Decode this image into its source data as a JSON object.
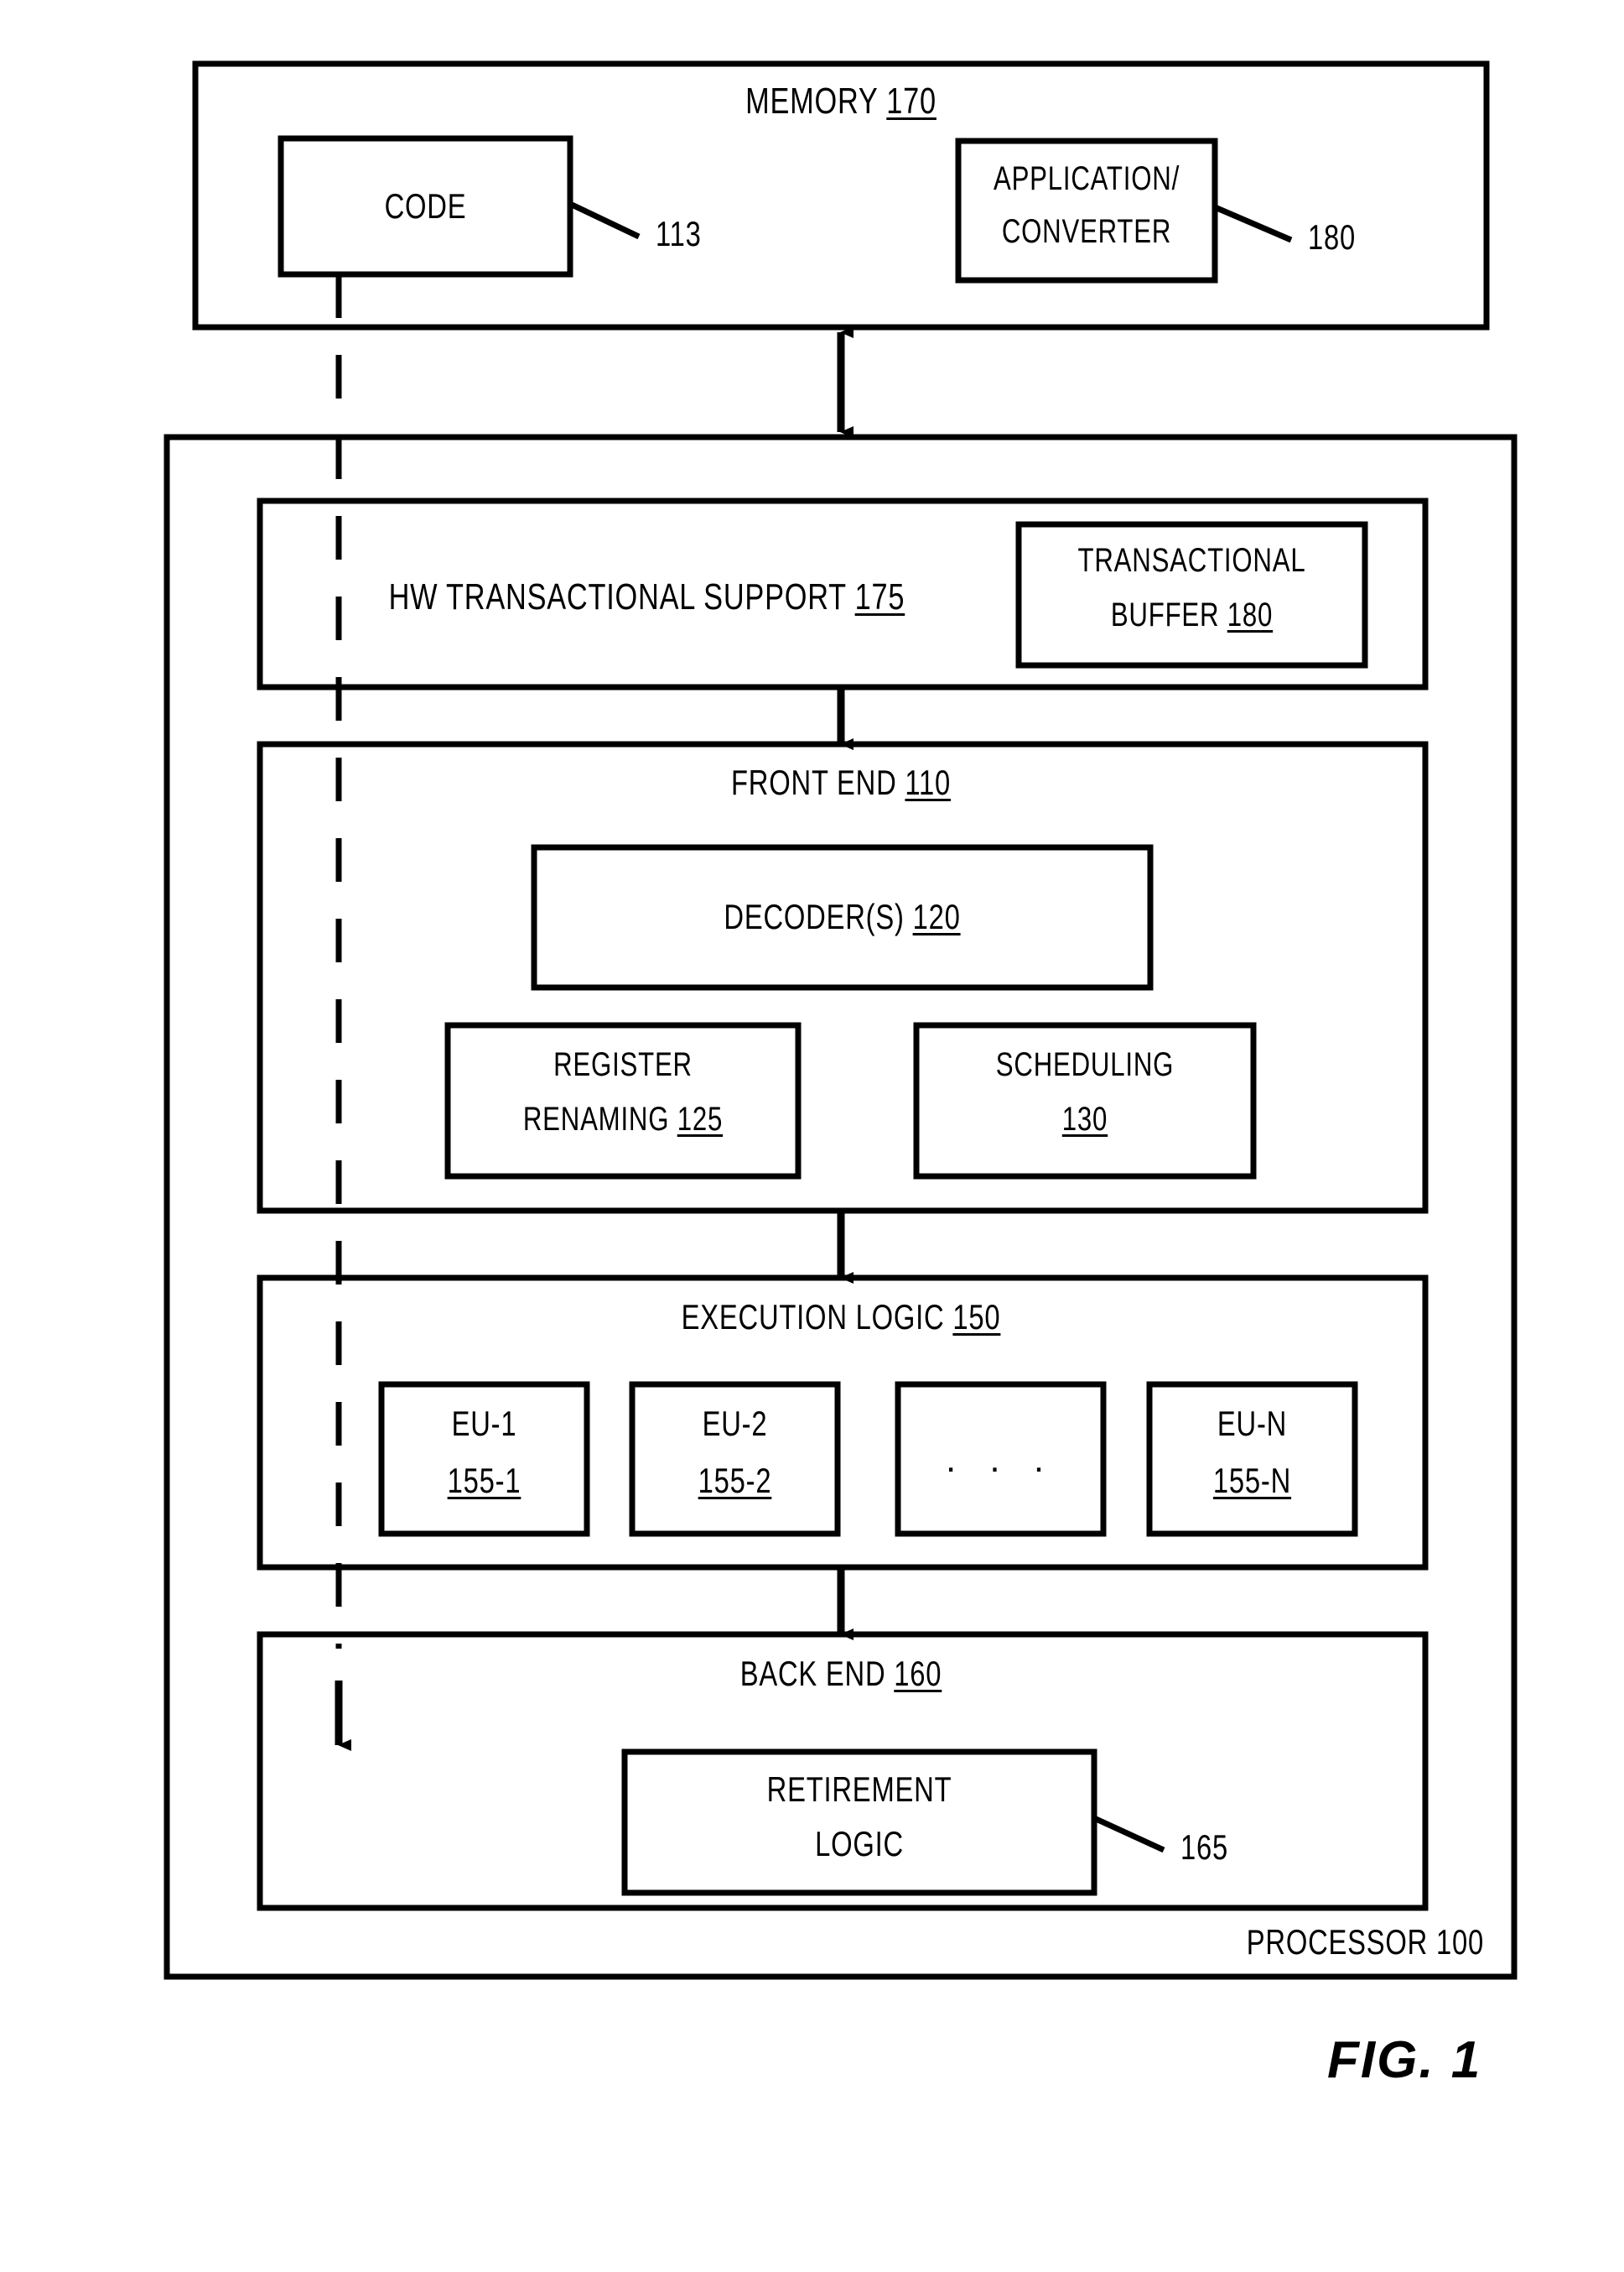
{
  "figure": {
    "caption": "FIG. 1",
    "memory": {
      "title": "MEMORY",
      "ref": "170",
      "code": {
        "label": "CODE",
        "ref": "113"
      },
      "application_converter": {
        "line1": "APPLICATION/",
        "line2": "CONVERTER",
        "ref": "180"
      }
    },
    "processor": {
      "title": "PROCESSOR",
      "ref": "100",
      "hw_transactional_support": {
        "label": "HW TRANSACTIONAL SUPPORT",
        "ref": "175"
      },
      "transactional_buffer": {
        "line1": "TRANSACTIONAL",
        "line2": "BUFFER",
        "ref": "180"
      },
      "front_end": {
        "label": "FRONT END",
        "ref": "110",
        "decoders": {
          "label": "DECODER(S)",
          "ref": "120"
        },
        "register_renaming": {
          "line1": "REGISTER",
          "line2": "RENAMING",
          "ref": "125"
        },
        "scheduling": {
          "line1": "SCHEDULING",
          "ref": "130"
        }
      },
      "execution_logic": {
        "label": "EXECUTION LOGIC",
        "ref": "150",
        "units": [
          {
            "name": "EU-1",
            "ref": "155-1"
          },
          {
            "name": "EU-2",
            "ref": "155-2"
          },
          {
            "name": "",
            "ref": "",
            "ellipsis": ". . ."
          },
          {
            "name": "EU-N",
            "ref": "155-N"
          }
        ]
      },
      "back_end": {
        "label": "BACK END",
        "ref": "160",
        "retirement_logic": {
          "line1": "RETIREMENT",
          "line2": "LOGIC",
          "ref": "165"
        }
      }
    }
  }
}
